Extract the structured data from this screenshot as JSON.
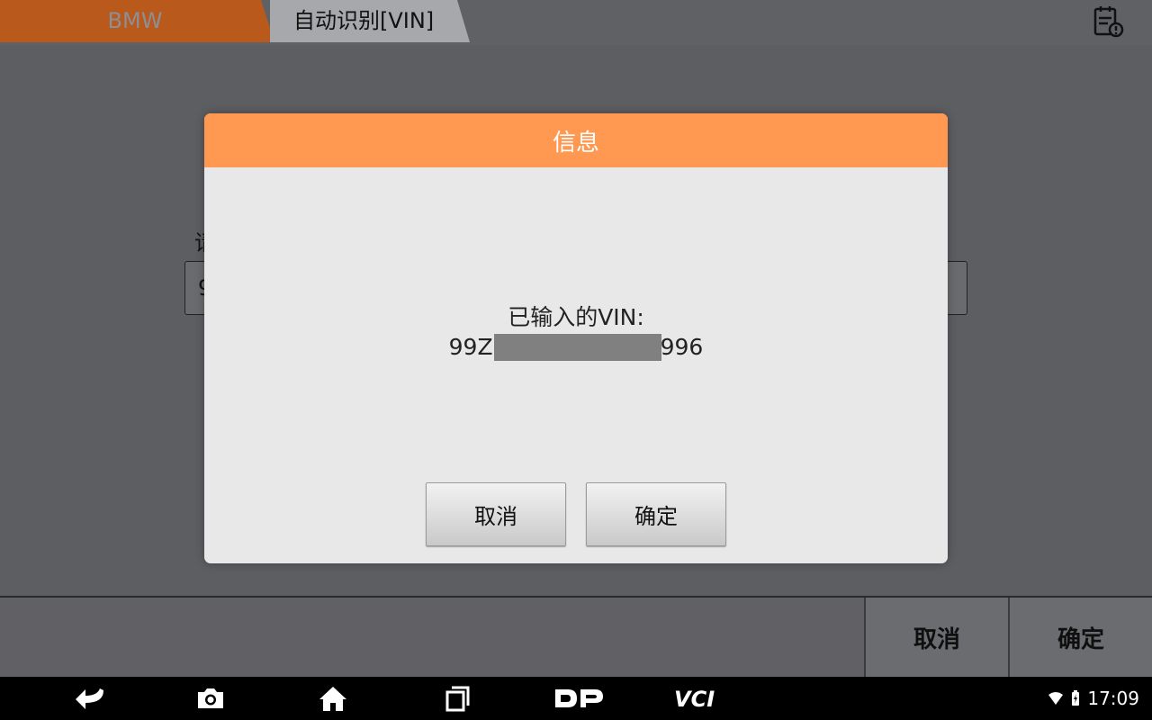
{
  "breadcrumb": {
    "items": [
      {
        "label": "BMW"
      },
      {
        "label": "自动识别[VIN]"
      }
    ]
  },
  "header": {
    "report_icon": "report-clock-icon"
  },
  "background": {
    "label_fragment": "请",
    "input_value_fragment": "9"
  },
  "dialog": {
    "title": "信息",
    "message_line1": "已输入的VIN:",
    "vin_prefix": "99Z",
    "vin_suffix": "996",
    "cancel_label": "取消",
    "ok_label": "确定"
  },
  "bottom": {
    "cancel_label": "取消",
    "ok_label": "确定"
  },
  "navbar": {
    "icons": [
      "back-icon",
      "camera-icon",
      "home-icon",
      "recent-apps-icon",
      "dp-logo-icon",
      "vci-logo-icon"
    ]
  },
  "status": {
    "time": "17:09"
  },
  "colors": {
    "accent": "#ff9850",
    "crumb_active": "#b9591c"
  }
}
